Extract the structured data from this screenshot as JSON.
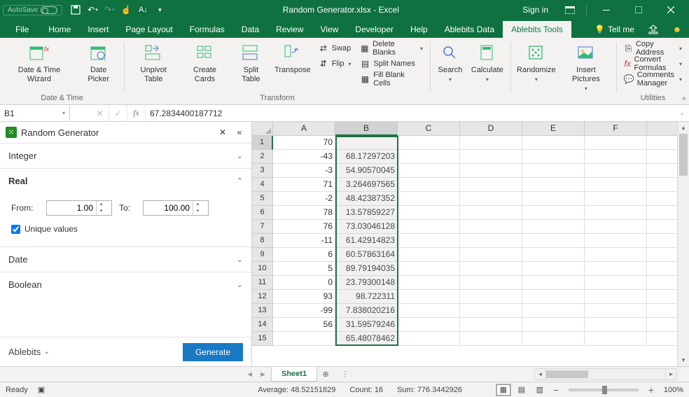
{
  "titlebar": {
    "autosave_label": "AutoSave",
    "title": "Random Generator.xlsx - Excel",
    "signin": "Sign in"
  },
  "tabs": {
    "file": "File",
    "items": [
      "Home",
      "Insert",
      "Page Layout",
      "Formulas",
      "Data",
      "Review",
      "View",
      "Developer",
      "Help",
      "Ablebits Data",
      "Ablebits Tools"
    ],
    "active": "Ablebits Tools",
    "tellme": "Tell me"
  },
  "ribbon": {
    "groups": {
      "datetime": {
        "label": "Date & Time",
        "date_time_wizard": "Date & Time Wizard",
        "date_picker": "Date Picker"
      },
      "transform": {
        "label": "Transform",
        "unpivot": "Unpivot Table",
        "create_cards": "Create Cards",
        "split_table": "Split Table",
        "transpose": "Transpose",
        "swap": "Swap",
        "flip": "Flip",
        "delete_blanks": "Delete Blanks",
        "split_names": "Split Names",
        "fill_blank": "Fill Blank Cells"
      },
      "search": "Search",
      "calculate": "Calculate",
      "randomize": "Randomize",
      "insert_pictures": "Insert Pictures",
      "utilities": {
        "label": "Utilities",
        "copy_address": "Copy Address",
        "convert_formulas": "Convert Formulas",
        "comments_manager": "Comments Manager"
      }
    }
  },
  "formula_bar": {
    "name": "B1",
    "value": "67.2834400187712"
  },
  "panel": {
    "title": "Random Generator",
    "sections": {
      "integer": "Integer",
      "real": "Real",
      "date": "Date",
      "boolean": "Boolean"
    },
    "real": {
      "from_label": "From:",
      "from_value": "1.00",
      "to_label": "To:",
      "to_value": "100.00",
      "unique_label": "Unique values"
    },
    "brand": "Ablebits",
    "generate": "Generate"
  },
  "grid": {
    "columns": [
      "A",
      "B",
      "C",
      "D",
      "E",
      "F"
    ],
    "selected_col": "B",
    "rows": [
      {
        "n": 1,
        "A": "70",
        "B": "67.28344002"
      },
      {
        "n": 2,
        "A": "-43",
        "B": "68.17297203"
      },
      {
        "n": 3,
        "A": "-3",
        "B": "54.90570045"
      },
      {
        "n": 4,
        "A": "71",
        "B": "3.264697565"
      },
      {
        "n": 5,
        "A": "-2",
        "B": "48.42387352"
      },
      {
        "n": 6,
        "A": "78",
        "B": "13.57859227"
      },
      {
        "n": 7,
        "A": "76",
        "B": "73.03046128"
      },
      {
        "n": 8,
        "A": "-11",
        "B": "61.42914823"
      },
      {
        "n": 9,
        "A": "6",
        "B": "60.57863164"
      },
      {
        "n": 10,
        "A": "5",
        "B": "89.79194035"
      },
      {
        "n": 11,
        "A": "0",
        "B": "23.79300148"
      },
      {
        "n": 12,
        "A": "93",
        "B": "98.722311"
      },
      {
        "n": 13,
        "A": "-99",
        "B": "7.838020216"
      },
      {
        "n": 14,
        "A": "56",
        "B": "31.59579246"
      },
      {
        "n": 15,
        "A": "",
        "B": "65.48078462"
      }
    ]
  },
  "sheettabs": {
    "active": "Sheet1"
  },
  "statusbar": {
    "ready": "Ready",
    "average_label": "Average:",
    "average": "48.52151829",
    "count_label": "Count:",
    "count": "16",
    "sum_label": "Sum:",
    "sum": "776.3442926",
    "zoom": "100%"
  }
}
